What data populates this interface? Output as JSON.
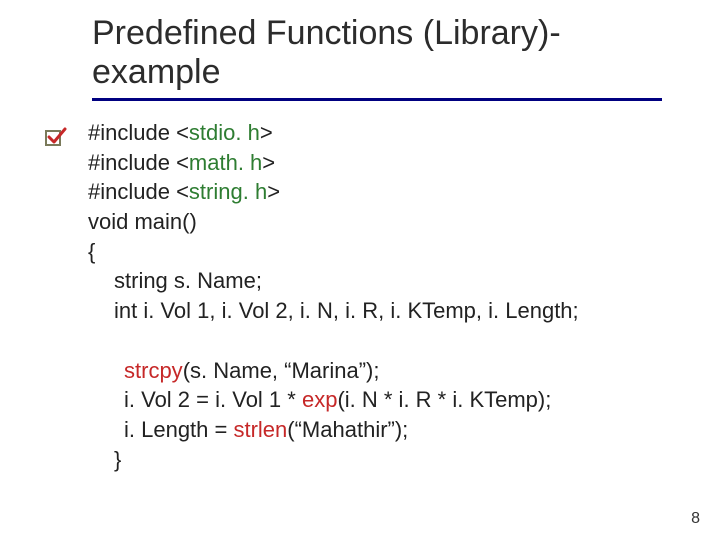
{
  "title": {
    "line1": "Predefined Functions (Library)-",
    "line2": "example"
  },
  "code": {
    "l1a": "#include <",
    "l1b": "stdio. h",
    "l1c": ">",
    "l2a": "#include <",
    "l2b": "math. h",
    "l2c": ">",
    "l3a": "#include <",
    "l3b": "string. h",
    "l3c": ">",
    "l4": "void main()",
    "l5": "{",
    "l6": "string s. Name;",
    "l7": "int i. Vol 1, i. Vol 2, i. N, i. R, i. KTemp, i. Length;",
    "l8a": "strcpy",
    "l8b": "(s. Name, “Marina”);",
    "l9a": "i. Vol 2 = i. Vol 1 * ",
    "l9b": "exp",
    "l9c": "(i. N * i. R * i. KTemp);",
    "l10a": "i. Length = ",
    "l10b": "strlen",
    "l10c": "(“Mahathir”);",
    "l11": "}"
  },
  "page_number": "8"
}
